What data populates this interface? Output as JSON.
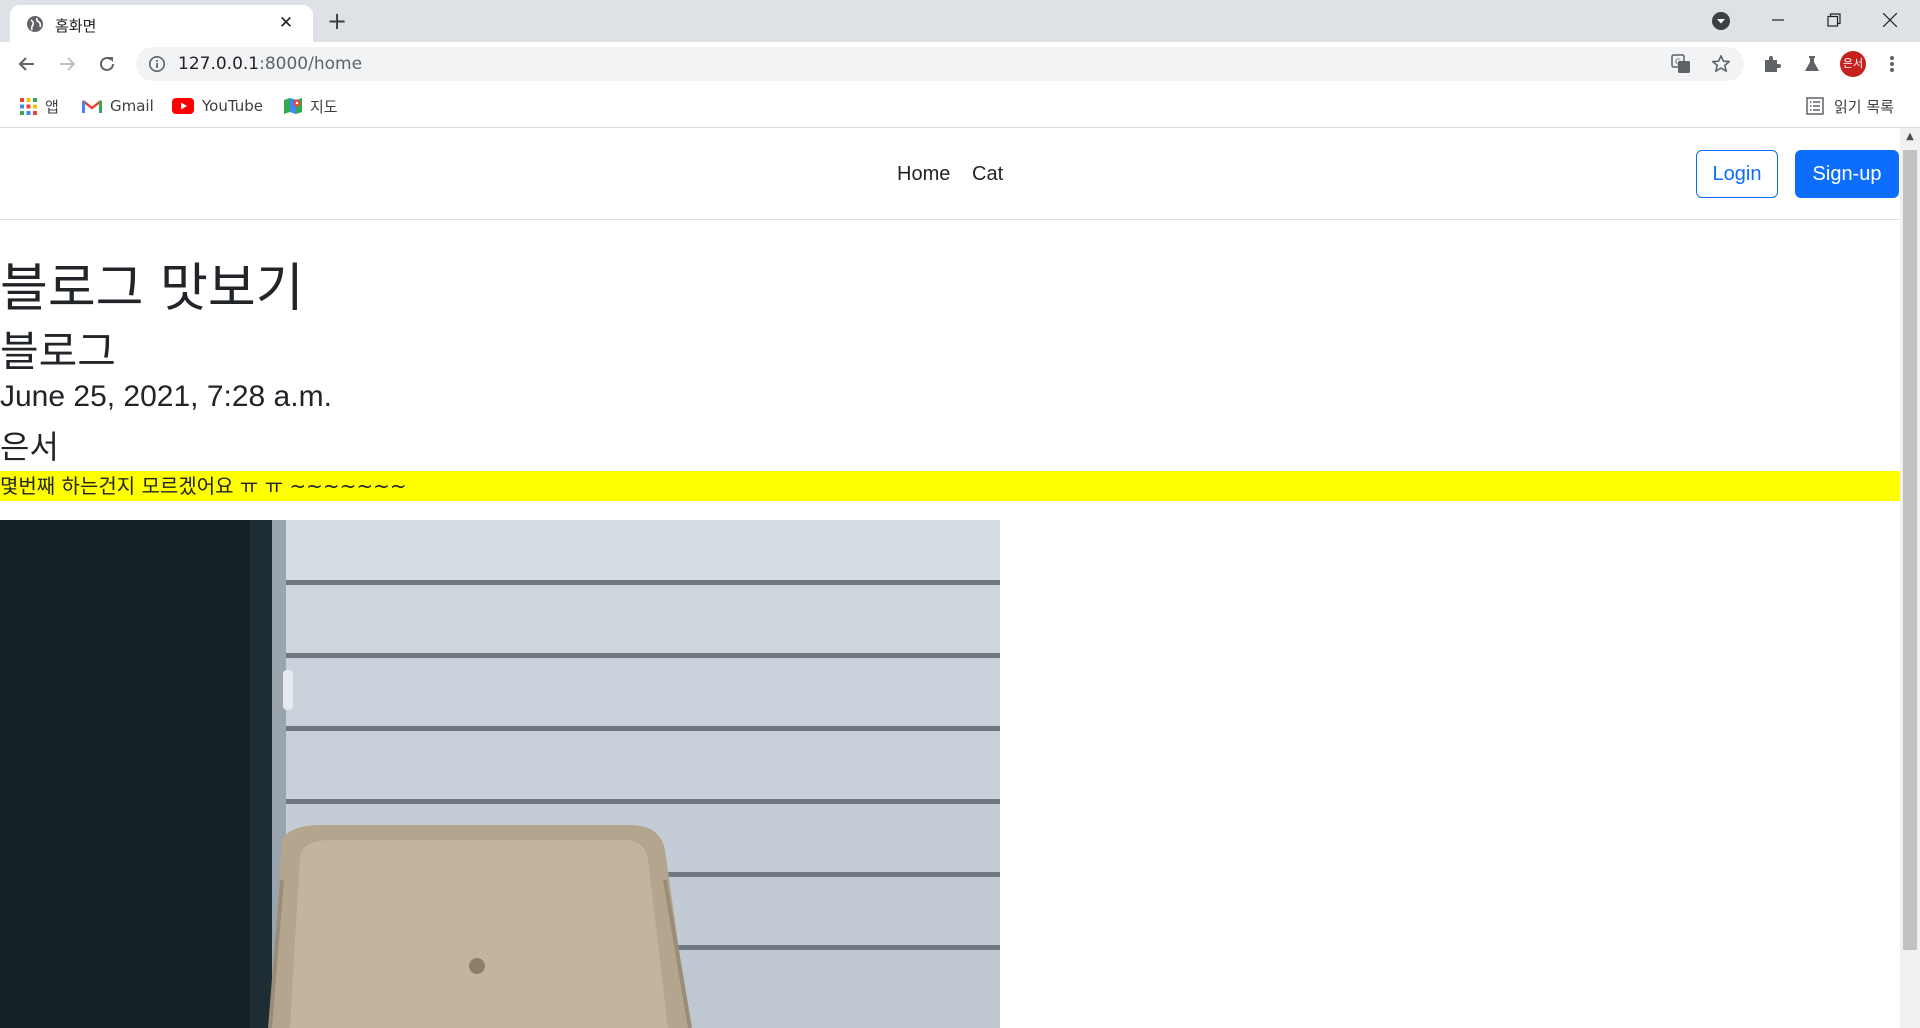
{
  "browser": {
    "tab": {
      "title": "홈화면",
      "close_glyph": "✕",
      "favicon": "globe-icon"
    },
    "new_tab_glyph": "+",
    "address": {
      "host": "127.0.0.1",
      "path": ":8000/home"
    },
    "profile_initials": "은서",
    "bookmarks": [
      {
        "label": "앱",
        "icon": "apps-grid-icon"
      },
      {
        "label": "Gmail",
        "icon": "gmail-icon"
      },
      {
        "label": "YouTube",
        "icon": "youtube-icon"
      },
      {
        "label": "지도",
        "icon": "maps-icon"
      }
    ],
    "reading_list": "읽기 목록"
  },
  "site": {
    "nav": {
      "home": "Home",
      "cat": "Cat"
    },
    "login": "Login",
    "signup": "Sign-up"
  },
  "blog": {
    "title": "블로그 맛보기",
    "post": {
      "title": "블로그",
      "date": "June 25, 2021, 7:28 a.m.",
      "author": "은서",
      "body": "몇번째 하는건지 모르겠어요 ㅠ ㅠ ~~~~~~~",
      "image": "armchair-photo"
    }
  },
  "colors": {
    "primary": "#0d6efd",
    "highlight": "#ffff00",
    "text": "#212529",
    "chrome_tabstrip": "#dee1e6"
  }
}
